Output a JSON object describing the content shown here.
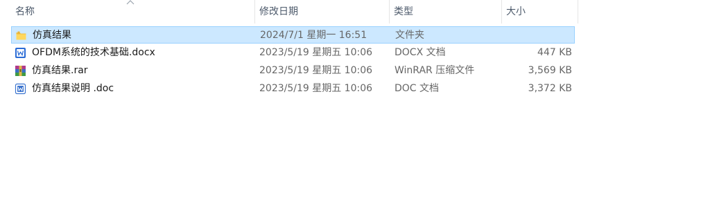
{
  "columns": {
    "name": "名称",
    "modified": "修改日期",
    "type": "类型",
    "size": "大小"
  },
  "sort": {
    "column": "name",
    "icon": "sort-up-chevron-icon"
  },
  "files": [
    {
      "name": "仿真结果",
      "modified": "2024/7/1 星期一 16:51",
      "type": "文件夹",
      "size": "",
      "icon": "folder-icon",
      "selected": true
    },
    {
      "name": "OFDM系统的技术基础.docx",
      "modified": "2023/5/19 星期五 10:06",
      "type": "DOCX 文档",
      "size": "447 KB",
      "icon": "word-docx-icon",
      "selected": false
    },
    {
      "name": "仿真结果.rar",
      "modified": "2023/5/19 星期五 10:06",
      "type": "WinRAR 压缩文件",
      "size": "3,569 KB",
      "icon": "winrar-archive-icon",
      "selected": false
    },
    {
      "name": "仿真结果说明 .doc",
      "modified": "2023/5/19 星期五 10:06",
      "type": "DOC 文档",
      "size": "3,372 KB",
      "icon": "word-doc-icon",
      "selected": false
    }
  ],
  "colors": {
    "selection_bg": "#cce8ff",
    "selection_border": "#99d1ff",
    "header_text": "#4d5a6b",
    "detail_text": "#666666"
  }
}
